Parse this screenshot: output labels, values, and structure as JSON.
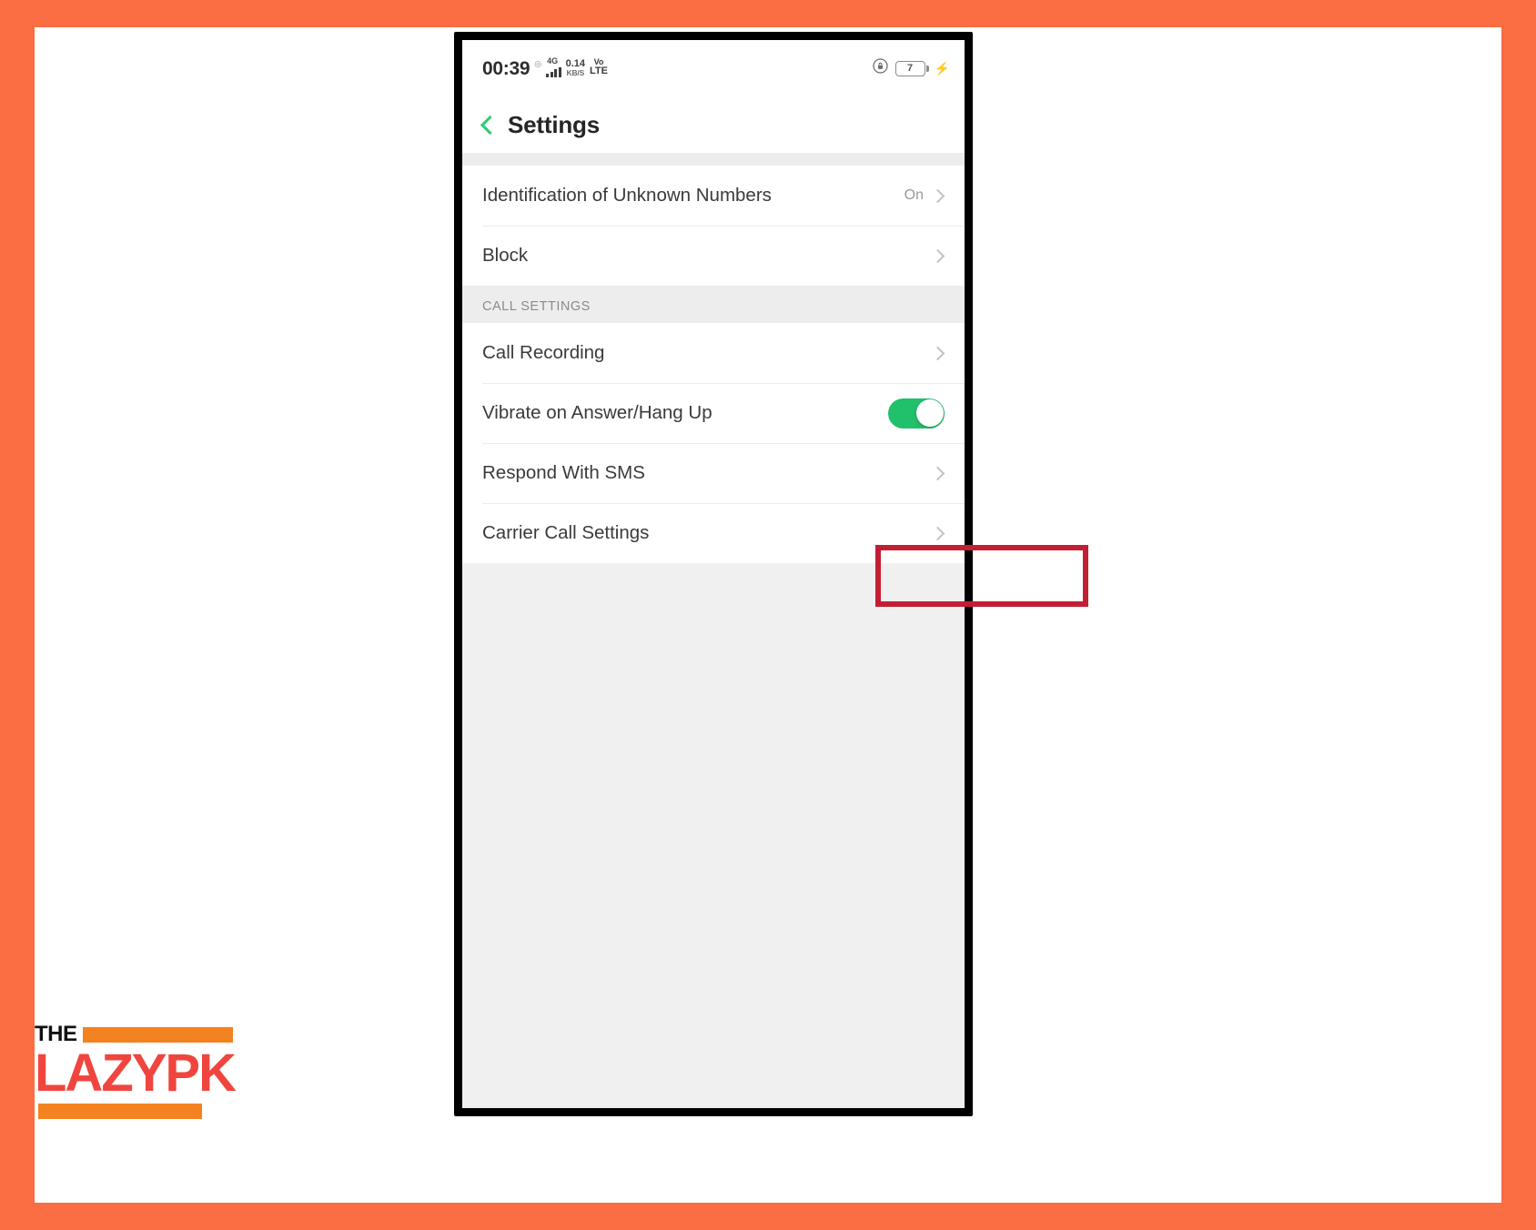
{
  "frame": {
    "border_color": "#fb6d42",
    "canvas_color": "#ffffff"
  },
  "phone": {
    "statusbar": {
      "time": "00:39",
      "dot_icon": "circle-dot-icon",
      "network_generation": "4G",
      "signal_icon": "signal-bars-icon",
      "data_rate_value": "0.14",
      "data_rate_unit": "KB/S",
      "volte_top": "Vo",
      "volte_bottom": "LTE",
      "rotation_lock_icon": "rotation-lock-icon",
      "battery_level": "7",
      "charging_icon": "lightning-bolt-icon"
    },
    "appbar": {
      "back_icon": "back-chevron-icon",
      "title": "Settings",
      "back_color": "#2ecb71"
    },
    "list": {
      "groups": [
        {
          "header": null,
          "rows": [
            {
              "label": "Identification of Unknown Numbers",
              "value": "On",
              "control": "chevron",
              "name": "identification-of-unknown-numbers"
            },
            {
              "label": "Block",
              "value": "",
              "control": "chevron",
              "name": "block"
            }
          ]
        },
        {
          "header": "CALL SETTINGS",
          "rows": [
            {
              "label": "Call Recording",
              "value": "",
              "control": "chevron",
              "name": "call-recording"
            },
            {
              "label": "Vibrate on Answer/Hang Up",
              "value": "",
              "control": "toggle",
              "toggle_state": "on",
              "toggle_color": "#21c06a",
              "name": "vibrate-on-answer-hang-up"
            },
            {
              "label": "Respond With SMS",
              "value": "",
              "control": "chevron",
              "name": "respond-with-sms"
            },
            {
              "label": "Carrier Call Settings",
              "value": "",
              "control": "chevron",
              "name": "carrier-call-settings",
              "highlighted": true
            }
          ]
        }
      ]
    }
  },
  "annotation": {
    "highlight_color": "#c41e34",
    "target_label": "Carrier Call Settings"
  },
  "logo": {
    "the_text": "THE",
    "main_text": "LAZYPK",
    "orange": "#f58220",
    "red": "#f0453f"
  }
}
